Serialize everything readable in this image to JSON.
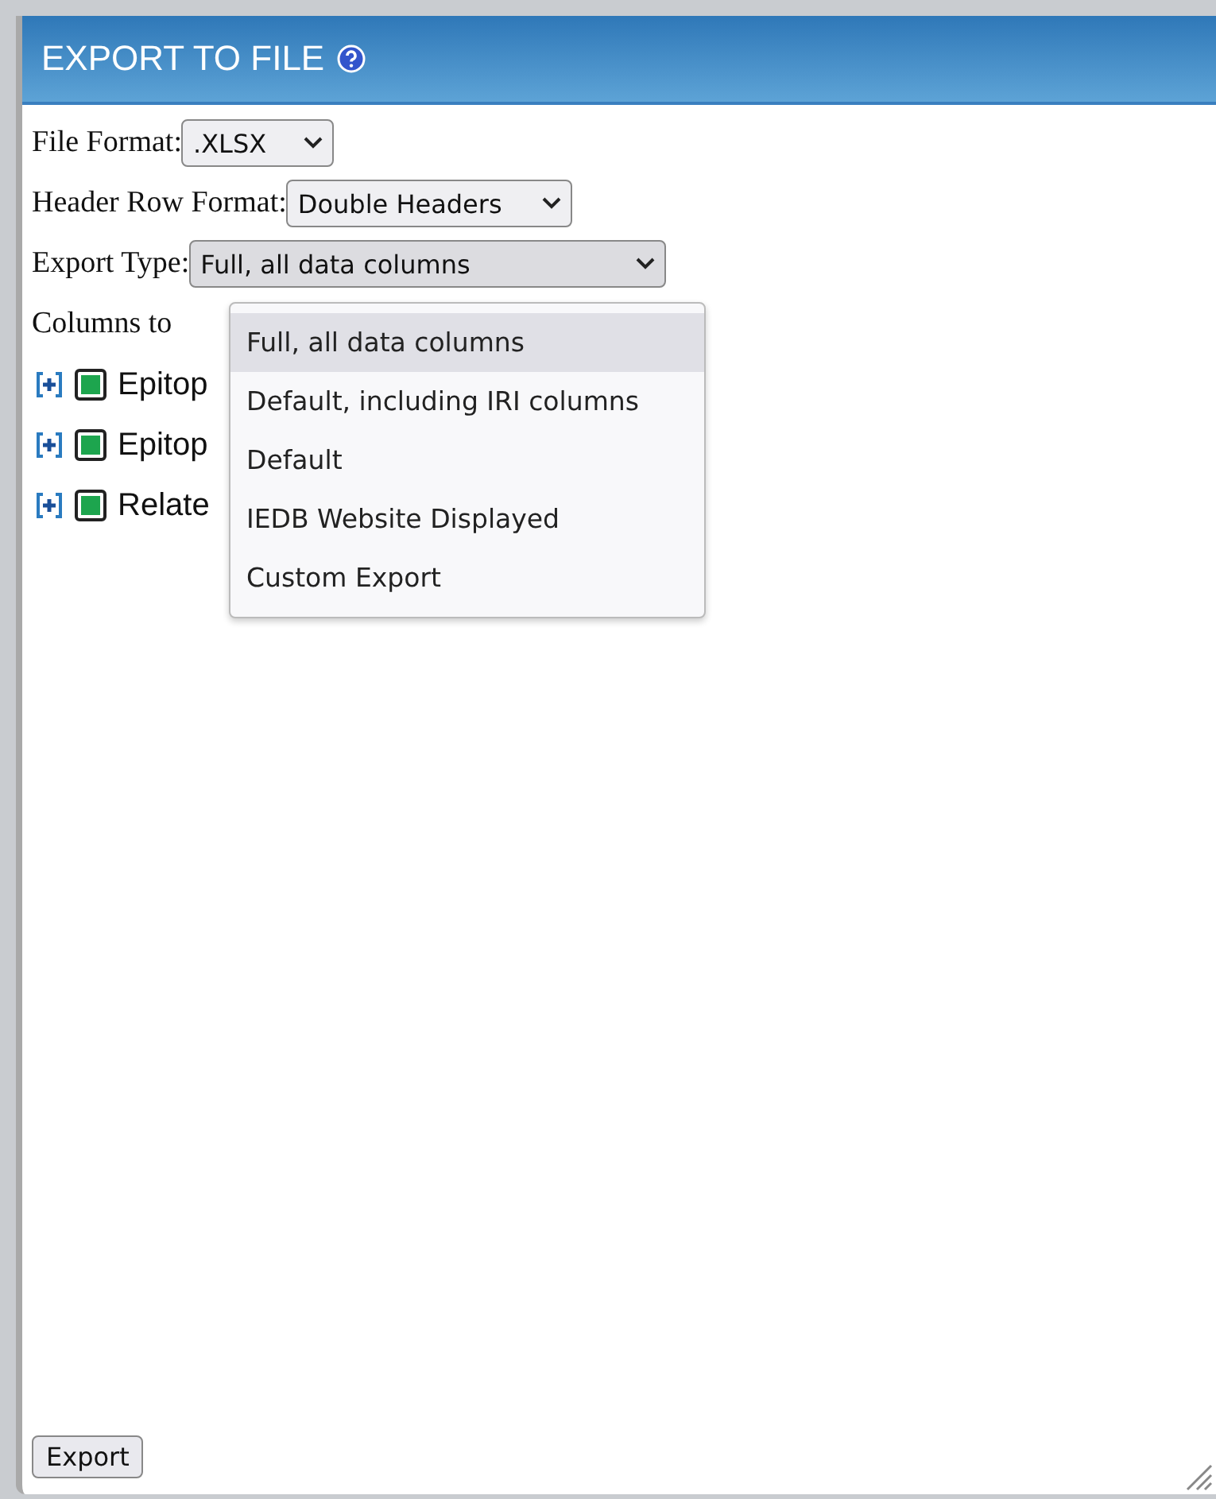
{
  "dialog": {
    "title": "EXPORT TO FILE"
  },
  "fields": [
    {
      "label": "File Format:",
      "value": ".XLSX"
    },
    {
      "label": "Header Row Format:",
      "value": "Double Headers"
    },
    {
      "label": "Export Type:",
      "value": "Full, all data columns",
      "open": true
    }
  ],
  "columns_label": "Columns to",
  "column_groups": [
    {
      "label": "Epitop",
      "checked": true,
      "expanded": false
    },
    {
      "label": "Epitop",
      "checked": true,
      "expanded": false
    },
    {
      "label": "Relate",
      "checked": true,
      "expanded": false
    }
  ],
  "export_type_options": [
    {
      "label": "Full, all data columns",
      "selected": true
    },
    {
      "label": "Default, including IRI columns",
      "selected": false
    },
    {
      "label": "Default",
      "selected": false
    },
    {
      "label": "IEDB Website Displayed",
      "selected": false
    },
    {
      "label": "Custom Export",
      "selected": false
    }
  ],
  "export_button": "Export"
}
